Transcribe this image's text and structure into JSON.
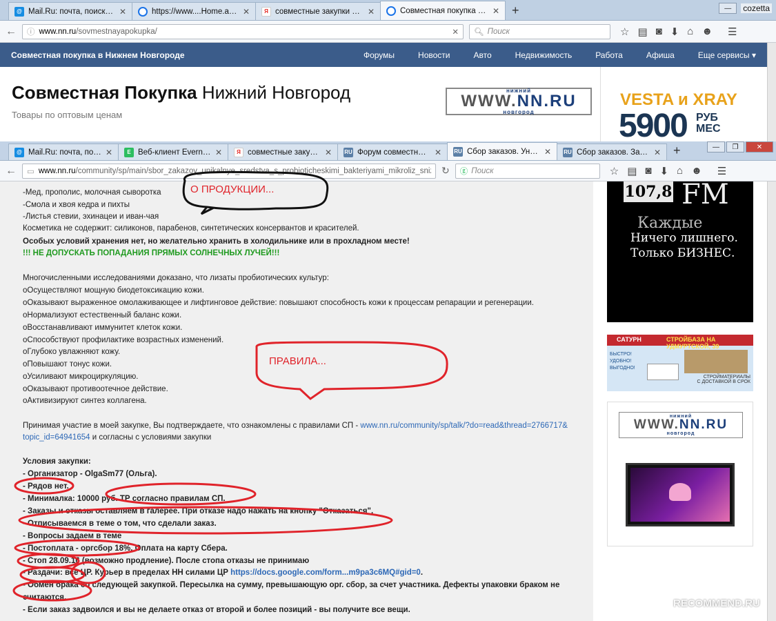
{
  "top_window": {
    "tabs": [
      {
        "label": "Mail.Ru: почта, поиск в ин...",
        "favicon": "mailru-icon",
        "color": "#168de2"
      },
      {
        "label": "https://www....Home.action",
        "favicon": "loading-icon",
        "color": "#1a73e8"
      },
      {
        "label": "совместные закупки — Я...",
        "favicon": "yandex-icon",
        "color": "#e52620"
      },
      {
        "label": "Совместная покупка Ниж...",
        "favicon": "loading-icon",
        "color": "#1a73e8"
      }
    ],
    "user": "cozetta",
    "url_domain": "www.nn.ru",
    "url_path": "/sovmestnayapokupka/",
    "search_placeholder": "Поиск"
  },
  "site": {
    "brand": "Совместная покупка в Нижнем Новгороде",
    "menu": [
      "Форумы",
      "Новости",
      "Авто",
      "Недвижимость",
      "Работа",
      "Афиша",
      "Еще сервисы ▾"
    ],
    "title_bold": "Совместная Покупка",
    "title_rest": " Нижний Новгород",
    "subtitle": "Товары по оптовым ценам",
    "logo_small_top": "нижний",
    "logo_www": "WWW.",
    "logo_nn": "NN.RU",
    "logo_small_bottom": "новгород",
    "ad_top_line": "VESTA и XRAY",
    "ad_price": "5900",
    "ad_unit": "РУБ МЕС"
  },
  "front_window": {
    "tabs": [
      {
        "label": "Mail.Ru: почта, поиск...",
        "favicon": "mailru-icon",
        "color": "#168de2"
      },
      {
        "label": "Веб-клиент Evernote",
        "favicon": "evernote-icon",
        "color": "#2dbe60"
      },
      {
        "label": "совместные закупки...",
        "favicon": "yandex-icon",
        "color": "#e52620"
      },
      {
        "label": "Форум совместная ...",
        "favicon": "ru-icon",
        "color": "#5b7fa6"
      },
      {
        "label": "Сбор заказов. Уника...",
        "favicon": "ru-icon",
        "color": "#5b7fa6"
      },
      {
        "label": "Сбор заказов. Загад...",
        "favicon": "ru-icon",
        "color": "#5b7fa6"
      }
    ],
    "url_domain": "www.nn.ru",
    "url_path": "/community/sp/main/sbor_zakazov_unikalnye_sredstva_s_probioticheskimi_bakteriyami_mikroliz_snizhenie_tsen_mc",
    "search_placeholder": "Поиск"
  },
  "content_lines": [
    {
      "text": "-Мед, прополис, молочная сыворотка",
      "style": "normal"
    },
    {
      "text": "-Смола и хвоя кедра и пихты",
      "style": "normal"
    },
    {
      "text": "-Листья стевии, эхинацеи и иван-чая",
      "style": "normal"
    },
    {
      "text": "Косметика не содержит: силиконов, парабенов, синтетических консервантов и красителей.",
      "style": "normal"
    },
    {
      "text": "Особых условий хранения нет, но желательно хранить в холодильнике или в прохладном месте!",
      "style": "bold"
    },
    {
      "text": "!!! НЕ ДОПУСКАТЬ ПОПАДАНИЯ ПРЯМЫХ СОЛНЕЧНЫХ ЛУЧЕЙ!!!",
      "style": "green"
    },
    {
      "text": "",
      "style": "normal"
    },
    {
      "text": "Многочисленными исследованиями доказано, что лизаты пробиотических культур:",
      "style": "normal"
    },
    {
      "text": "оОсуществляют мощную биодетоксикацию кожи.",
      "style": "normal"
    },
    {
      "text": "оОказывают выраженное омолаживающее и лифтинговое действие: повышают способность кожи к процессам репарации и регенерации.",
      "style": "normal"
    },
    {
      "text": "оНормализуют естественный баланс кожи.",
      "style": "normal"
    },
    {
      "text": "оВосстанавливают иммунитет клеток кожи.",
      "style": "normal"
    },
    {
      "text": "оСпособствуют профилактике возрастных изменений.",
      "style": "normal"
    },
    {
      "text": "оГлубоко увлажняют кожу.",
      "style": "normal"
    },
    {
      "text": "оПовышают тонус кожи.",
      "style": "normal"
    },
    {
      "text": "оУсиливают микроциркуляцию.",
      "style": "normal"
    },
    {
      "text": "оОказывают противоотечное действие.",
      "style": "normal"
    },
    {
      "text": "оАктивизируют синтез коллагена.",
      "style": "normal"
    }
  ],
  "rules_text": "Принимая участие в моей закупке, Вы подтверждаете, что ознакомлены с правилами СП - ",
  "rules_link": "www.nn.ru/community/sp/talk/?do=read&thread=2766717&",
  "rules_link2": "topic_id=64941654",
  "rules_tail": " и согласны с условиями закупки",
  "conditions_title": "Условия закупки:",
  "conditions": [
    "- Организатор - OlgaSm77 (Ольга).",
    "- Рядов нет.",
    "- Минималка: 10000 руб. ТР согласно правилам СП.",
    "- Заказы и отказы оставляем в галерее. При отказе надо нажать на кнопку \"Отказаться\".",
    "- Отписываемся в теме о том, что сделали заказ.",
    "- Вопросы задаем в теме",
    "- Постоплата - оргсбор 18%. Оплата на карту Сбера.",
    "- Стоп 28.09.16 (возможно продление). После стопа отказы не принимаю",
    "- Раздачи: все ЦР. Курьер в пределах НН силами ЦР ",
    "- Обмен брака со следующей закупкой. Пересылка на сумму, превышающую орг. сбор, за счет участника. Дефекты упаковки браком не",
    "считаются.",
    "- Если заказ задвоился и вы не делаете отказ от второй и более позиций - вы получите все вещи."
  ],
  "gdocs_link": "https://docs.google.com/form...m9pa3c6MQ#gid=0",
  "annotations": {
    "products": "О ПРОДУКЦИИ...",
    "rules": "ПРАВИЛА..."
  },
  "ads": {
    "radio_freq": "107,8",
    "radio_fm": "FM",
    "radio_line1": "Каждые",
    "radio_line2": "Ничего лишнего.",
    "radio_line3": "Только БИЗНЕС.",
    "saturn_brand": "САТУРН",
    "saturn_head": "СТРОЙБАЗА НА УДМУРТСКОЙ, 39",
    "saturn_l1": "БЫСТРО!",
    "saturn_l2": "УДОБНО!",
    "saturn_l3": "ВЫГОДНО!",
    "saturn_foot1": "СТРОЙМАТЕРИАЛЫ",
    "saturn_foot2": "С ДОСТАВКОЙ В СРОК"
  },
  "watermark": "RECOMMEND.RU"
}
